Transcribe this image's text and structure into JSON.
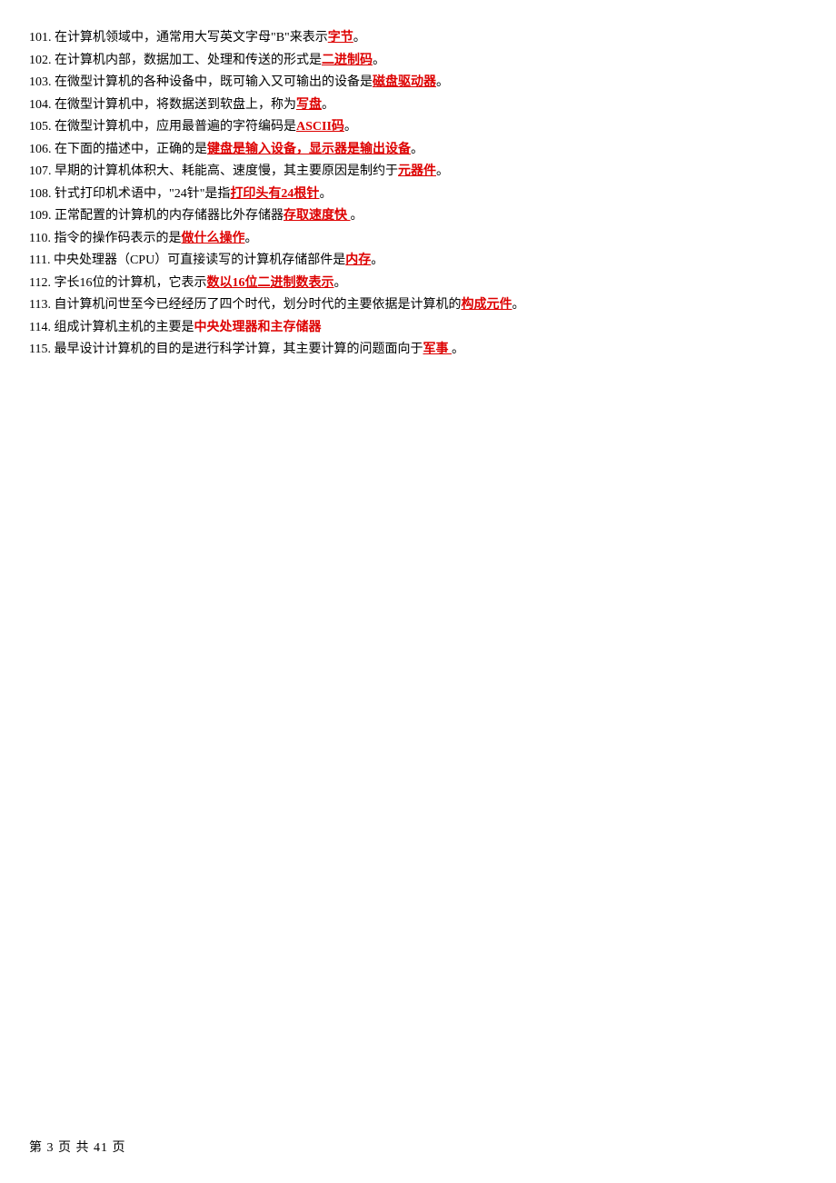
{
  "items": [
    {
      "num": "101. ",
      "pre": "在计算机领域中，通常用大写英文字母\"B\"来表示",
      "ans": "字节",
      "post": "。",
      "under": true
    },
    {
      "num": "102. ",
      "pre": "在计算机内部，数据加工、处理和传送的形式是",
      "ans": "二进制码",
      "post": "。",
      "under": true
    },
    {
      "num": "103. ",
      "pre": "在微型计算机的各种设备中，既可输入又可输出的设备是",
      "ans": "磁盘驱动器",
      "post": "。",
      "under": true
    },
    {
      "num": "104. ",
      "pre": "在微型计算机中，将数据送到软盘上，称为",
      "ans": "写盘",
      "post": "。",
      "under": true
    },
    {
      "num": "105. ",
      "pre": "在微型计算机中，应用最普遍的字符编码是",
      "ans": "ASCII码",
      "post": "。",
      "under": true
    },
    {
      "num": "106. ",
      "pre": "在下面的描述中，正确的是",
      "ans": "键盘是输入设备，显示器是输出设备",
      "post": "。",
      "under": true
    },
    {
      "num": "107. ",
      "pre": "早期的计算机体积大、耗能高、速度慢，其主要原因是制约于",
      "ans": "元器件",
      "post": "。",
      "under": true
    },
    {
      "num": "108. ",
      "pre": "针式打印机术语中，\"24针\"是指",
      "ans": "打印头有24根针",
      "post": "。",
      "under": true
    },
    {
      "num": "109. ",
      "pre": "正常配置的计算机的内存储器比外存储器",
      "ans": "存取速度快 ",
      "post": "。",
      "under": true
    },
    {
      "num": "110. ",
      "pre": "指令的操作码表示的是",
      "ans": "做什么操作",
      "post": "。",
      "under": true
    },
    {
      "num": "111. ",
      "pre": "中央处理器（CPU）可直接读写的计算机存储部件是",
      "ans": "内存",
      "post": "。",
      "under": true
    },
    {
      "num": "112. ",
      "pre": "字长16位的计算机，它表示",
      "ans": "数以16位二进制数表示",
      "post": "。",
      "under": true
    },
    {
      "num": "113. ",
      "pre": "自计算机问世至今已经经历了四个时代，划分时代的主要依据是计算机的",
      "ans": "构成元件",
      "post": "。",
      "under": true
    },
    {
      "num": "114. ",
      "pre": "组成计算机主机的主要是",
      "ans": "中央处理器和主存储器",
      "post": "",
      "under": false
    },
    {
      "num": "115. ",
      "pre": "最早设计计算机的目的是进行科学计算，其主要计算的问题面向于",
      "ans": "军事 ",
      "post": "。",
      "under": true
    }
  ],
  "footer": "第 3 页 共 41 页"
}
